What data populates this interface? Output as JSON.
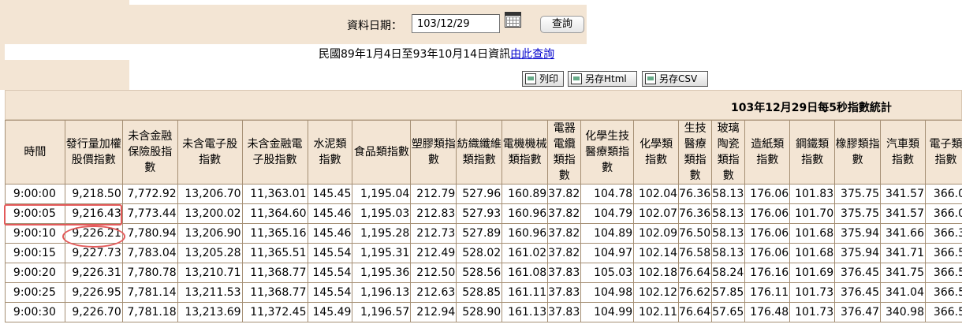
{
  "form": {
    "date_label": "資料日期：",
    "date_value": "103/12/29",
    "query_button": "查詢"
  },
  "notice": {
    "text": "民國89年1月4日至93年10月14日資訊",
    "link": "由此查詢"
  },
  "toolbar": {
    "print": "列印",
    "save_html": "另存Html",
    "save_csv": "另存CSV"
  },
  "table": {
    "title": "103年12月29日每5秒指數統計",
    "headers": [
      "時間",
      "發行量加權股價指數",
      "未含金融保險股指數",
      "未含電子股指數",
      "未含金融電子股指數",
      "水泥類指數",
      "食品類指數",
      "塑膠類指數",
      "紡織纖維類指數",
      "電機機械類指數",
      "電器電纜類指數",
      "化學生技醫療類指數",
      "化學類指數",
      "生技醫療類指數",
      "玻璃陶瓷類指數",
      "造紙類指數",
      "鋼鐵類指數",
      "橡膠類指數",
      "汽車類指數",
      "電子類指數"
    ],
    "rows": [
      [
        "9:00:00",
        "9,218.50",
        "7,772.92",
        "13,206.70",
        "11,363.01",
        "145.45",
        "1,195.04",
        "212.79",
        "527.96",
        "160.89",
        "37.82",
        "104.78",
        "102.04",
        "76.36",
        "58.13",
        "176.06",
        "101.83",
        "375.75",
        "341.57",
        "366.0"
      ],
      [
        "9:00:05",
        "9,216.43",
        "7,773.44",
        "13,200.02",
        "11,364.60",
        "145.46",
        "1,195.03",
        "212.83",
        "527.93",
        "160.96",
        "37.82",
        "104.79",
        "102.07",
        "76.36",
        "58.13",
        "176.06",
        "101.70",
        "375.75",
        "341.57",
        "366.0"
      ],
      [
        "9:00:10",
        "9,226.21",
        "7,780.94",
        "13,206.90",
        "11,365.16",
        "145.46",
        "1,195.28",
        "212.73",
        "527.89",
        "160.96",
        "37.82",
        "104.89",
        "102.09",
        "76.50",
        "58.13",
        "176.06",
        "101.68",
        "375.94",
        "341.66",
        "366.3"
      ],
      [
        "9:00:15",
        "9,227.73",
        "7,783.04",
        "13,205.28",
        "11,365.51",
        "145.54",
        "1,195.31",
        "212.49",
        "528.02",
        "161.02",
        "37.82",
        "104.97",
        "102.14",
        "76.58",
        "58.13",
        "176.06",
        "101.68",
        "375.94",
        "341.71",
        "366.5"
      ],
      [
        "9:00:20",
        "9,226.31",
        "7,780.78",
        "13,210.71",
        "11,368.77",
        "145.54",
        "1,195.36",
        "212.50",
        "528.56",
        "161.08",
        "37.83",
        "105.03",
        "102.18",
        "76.64",
        "58.24",
        "176.16",
        "101.69",
        "376.45",
        "341.75",
        "366.5"
      ],
      [
        "9:00:25",
        "9,226.95",
        "7,781.14",
        "13,211.53",
        "11,368.77",
        "145.54",
        "1,196.13",
        "212.63",
        "528.85",
        "161.11",
        "37.83",
        "104.98",
        "102.12",
        "76.62",
        "57.85",
        "176.11",
        "101.73",
        "376.45",
        "341.04",
        "366.5"
      ],
      [
        "9:00:30",
        "9,226.70",
        "7,781.18",
        "13,213.69",
        "11,372.45",
        "145.49",
        "1,196.57",
        "212.94",
        "528.90",
        "161.13",
        "37.83",
        "104.99",
        "102.11",
        "76.64",
        "57.65",
        "176.48",
        "101.73",
        "376.47",
        "340.98",
        "366.5"
      ]
    ]
  },
  "colors": {
    "panel_background": "#f3e5d4",
    "grid_border": "#a58f74",
    "link": "#0000cc",
    "annotation": "#e35a5a"
  }
}
